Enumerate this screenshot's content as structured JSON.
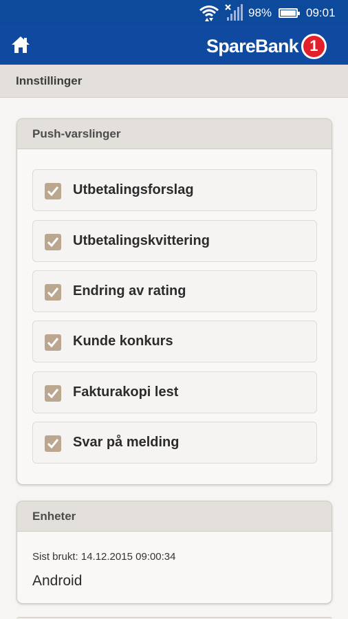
{
  "status_bar": {
    "battery_text": "98%",
    "battery_level": 0.98,
    "time": "09:01",
    "icons": [
      "wifi-icon",
      "signal-icon",
      "battery-icon"
    ]
  },
  "app_bar": {
    "brand_name": "SpareBank",
    "brand_number": "1",
    "home_icon": "home-icon",
    "colors": {
      "bar": "#0f4aa0",
      "brand_badge": "#e2202a"
    }
  },
  "page": {
    "title": "Innstillinger"
  },
  "push_panel": {
    "title": "Push-varslinger",
    "items": [
      {
        "label": "Utbetalingsforslag",
        "checked": true
      },
      {
        "label": "Utbetalingskvittering",
        "checked": true
      },
      {
        "label": "Endring av rating",
        "checked": true
      },
      {
        "label": "Kunde konkurs",
        "checked": true
      },
      {
        "label": "Fakturakopi lest",
        "checked": true
      },
      {
        "label": "Svar på melding",
        "checked": true
      }
    ],
    "checkbox_color": "#bba78f"
  },
  "devices_panel": {
    "title": "Enheter",
    "last_used": "Sist brukt: 14.12.2015 09:00:34",
    "device_name": "Android"
  }
}
